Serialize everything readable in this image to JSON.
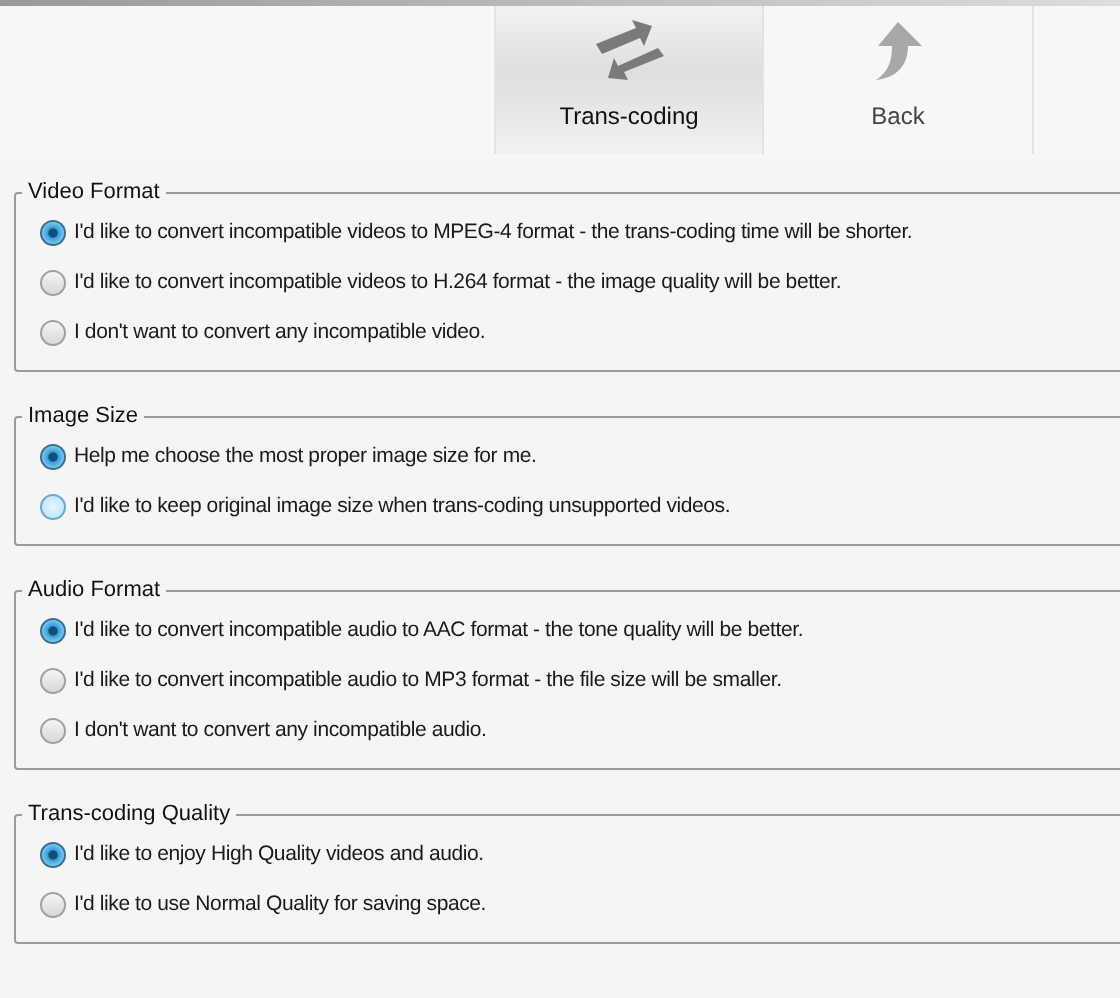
{
  "toolbar": [
    {
      "kind": "transcode",
      "label": "Trans-coding",
      "selected": true
    },
    {
      "kind": "back",
      "label": "Back",
      "selected": false
    }
  ],
  "sections": [
    {
      "title": "Video Format",
      "options": [
        {
          "label": "I'd like to convert incompatible videos to MPEG-4 format - the trans-coding time will be shorter.",
          "selected": true,
          "focused": false
        },
        {
          "label": "I'd like to convert incompatible videos to H.264 format - the image quality will be better.",
          "selected": false,
          "focused": false
        },
        {
          "label": "I don't want to convert any incompatible video.",
          "selected": false,
          "focused": false
        }
      ]
    },
    {
      "title": "Image Size",
      "options": [
        {
          "label": "Help me choose the most proper image size for me.",
          "selected": true,
          "focused": false
        },
        {
          "label": "I'd like to keep original image size when trans-coding unsupported videos.",
          "selected": false,
          "focused": true
        }
      ]
    },
    {
      "title": "Audio Format",
      "options": [
        {
          "label": "I'd like to convert incompatible audio to AAC format - the tone quality will be better.",
          "selected": true,
          "focused": false
        },
        {
          "label": "I'd like to convert incompatible audio to MP3 format - the file size will be smaller.",
          "selected": false,
          "focused": false
        },
        {
          "label": "I don't want to convert any incompatible audio.",
          "selected": false,
          "focused": false
        }
      ]
    },
    {
      "title": "Trans-coding Quality",
      "options": [
        {
          "label": "I'd like to enjoy High Quality videos and audio.",
          "selected": true,
          "focused": false
        },
        {
          "label": "I'd like to use Normal Quality for saving space.",
          "selected": false,
          "focused": false
        }
      ]
    }
  ]
}
